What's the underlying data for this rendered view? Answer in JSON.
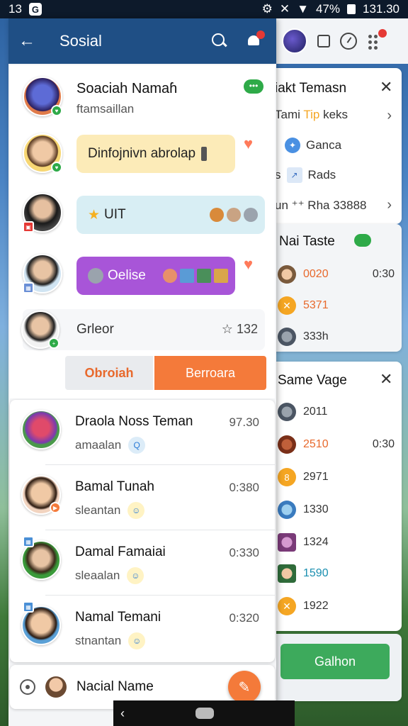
{
  "status": {
    "time_left": "13",
    "app_glyph": "G",
    "battery_text": "47%",
    "clock": "131.30"
  },
  "appbar": {
    "title": "Sosial"
  },
  "profile": {
    "name": "Soaciah Namaɦ",
    "subtitle": "ftamsaillan"
  },
  "bubbles": [
    {
      "text": "Dinfojnivn abrolap"
    },
    {
      "text": "UIT"
    },
    {
      "text": "Oelise"
    }
  ],
  "rating_row": {
    "name": "Grleor",
    "count": "132"
  },
  "buttons": {
    "secondary": "Obroiah",
    "primary": "Berroara"
  },
  "list": [
    {
      "name": "Draola Noss Teman",
      "sub": "amaalan",
      "time": "97.30"
    },
    {
      "name": "Bamal Tunah",
      "sub": "sleantan",
      "time": "0:380"
    },
    {
      "name": "Damal Famaiai",
      "sub": "sleaalan",
      "time": "0:330"
    },
    {
      "name": "Namal Temani",
      "sub": "stnantan",
      "time": "0:320"
    }
  ],
  "bottom": {
    "name": "Nacial Name"
  },
  "side": {
    "card1": {
      "title": "iakt Temasn",
      "rows": [
        {
          "prefix": "Tami",
          "accent": "Tip",
          "suffix": "keks"
        },
        {
          "label": "Ganca"
        },
        {
          "label": "Rads",
          "lead": "s"
        },
        {
          "label": "un ⁺⁺ Rha 33888"
        }
      ]
    },
    "card2": {
      "title": "Nai Taste",
      "rows": [
        {
          "score": "0020",
          "time": "0:30",
          "color": "#e8692c"
        },
        {
          "score": "5371",
          "time": "",
          "color": "#e8692c"
        },
        {
          "score": "333h",
          "time": "",
          "color": "#333333"
        }
      ]
    },
    "card3": {
      "title": "Same Vage",
      "rows": [
        {
          "score": "2011",
          "time": "",
          "color": "#333333"
        },
        {
          "score": "2510",
          "time": "0:30",
          "color": "#e8692c"
        },
        {
          "score": "2971",
          "time": "",
          "color": "#333333"
        },
        {
          "score": "1330",
          "time": "",
          "color": "#333333"
        },
        {
          "score": "1324",
          "time": "",
          "color": "#333333"
        },
        {
          "score": "1590",
          "time": "",
          "color": "#1a8fb0"
        },
        {
          "score": "1922",
          "time": "",
          "color": "#333333"
        }
      ]
    },
    "card4": {
      "button": "Galhon"
    }
  },
  "colors": {
    "appbar": "#1f4f85",
    "accent": "#f47a3a",
    "green": "#3daa5c"
  }
}
